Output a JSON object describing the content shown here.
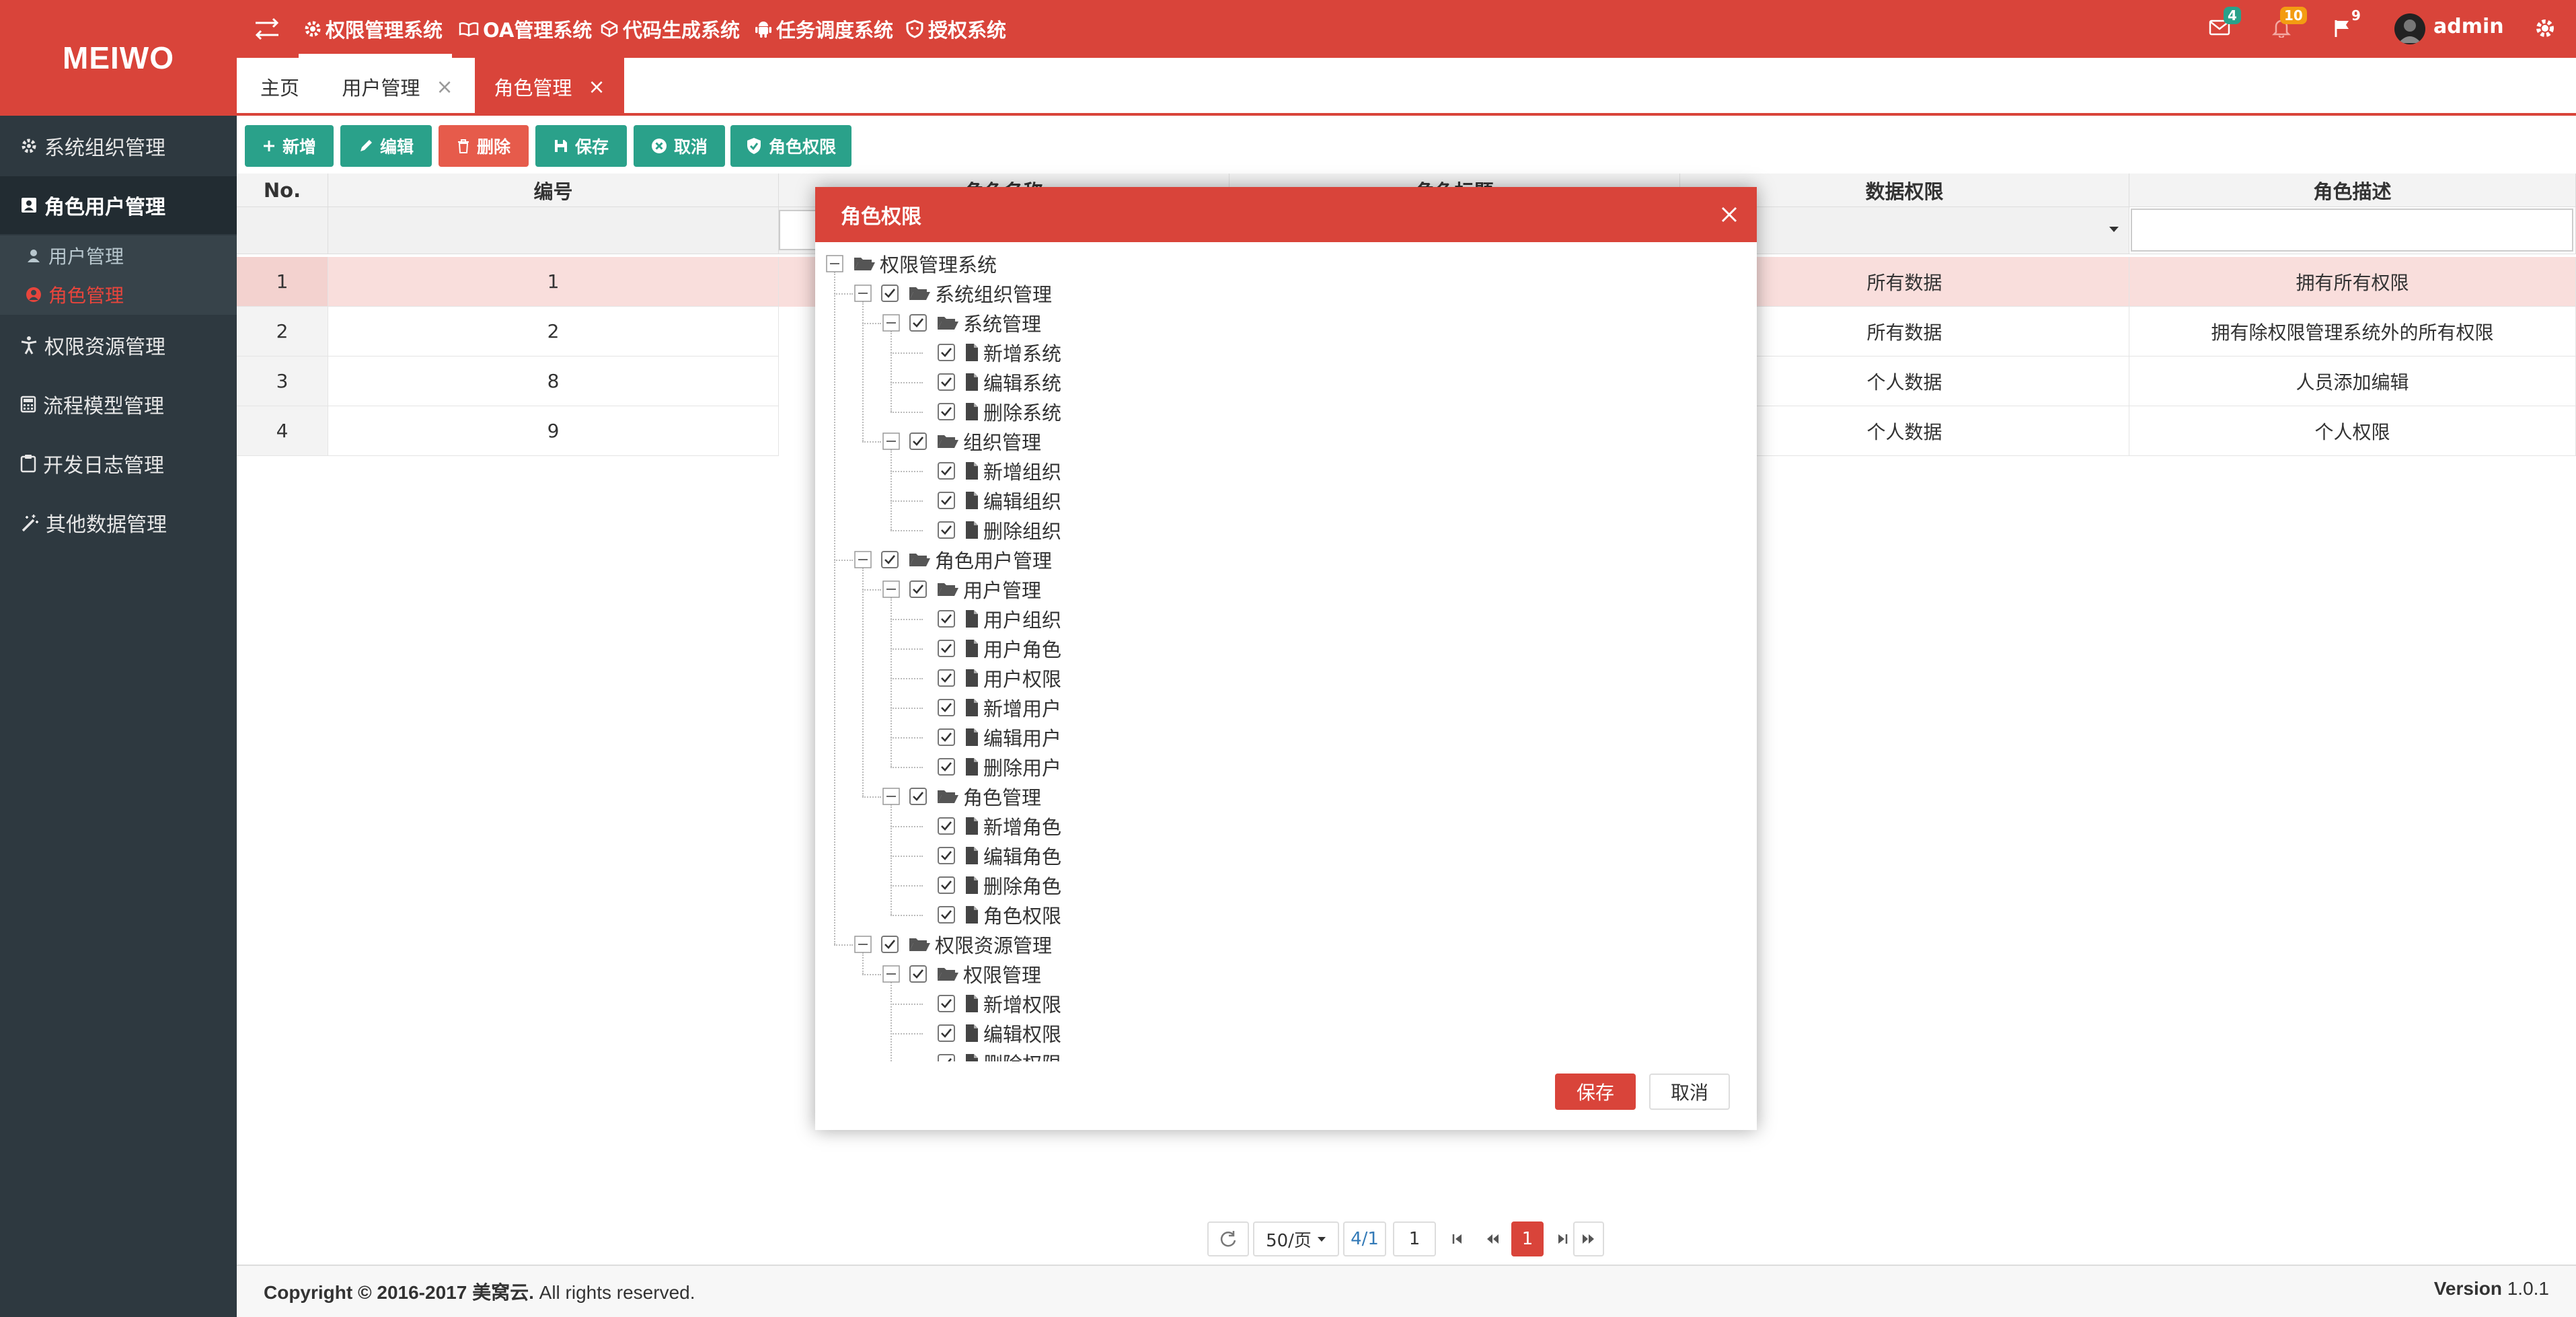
{
  "brand": {
    "logo": "MEIWO",
    "accent": "#d9443a",
    "sidebar_bg": "#2e3940",
    "teal": "#2aa18a"
  },
  "topbar": {
    "systems": [
      {
        "label": "权限管理系统",
        "icon": "gear-icon",
        "active": true
      },
      {
        "label": "OA管理系统",
        "icon": "book-icon"
      },
      {
        "label": "代码生成系统",
        "icon": "cube-icon"
      },
      {
        "label": "任务调度系统",
        "icon": "android-icon"
      },
      {
        "label": "授权系统",
        "icon": "shield-icon"
      }
    ],
    "badges": {
      "mail": "4",
      "bell": "10",
      "flag": "9"
    },
    "user": "admin"
  },
  "tabs": [
    {
      "label": "主页"
    },
    {
      "label": "用户管理",
      "closable": true
    },
    {
      "label": "角色管理",
      "closable": true,
      "active": true
    }
  ],
  "sidebar": {
    "items": [
      {
        "label": "系统组织管理",
        "icon": "gear-icon"
      },
      {
        "label": "角色用户管理",
        "icon": "id-card-icon",
        "active": true
      },
      {
        "label": "权限资源管理",
        "icon": "person-icon"
      },
      {
        "label": "流程模型管理",
        "icon": "calculator-icon"
      },
      {
        "label": "开发日志管理",
        "icon": "clipboard-icon"
      },
      {
        "label": "其他数据管理",
        "icon": "wand-icon"
      }
    ],
    "subitems": [
      {
        "label": "用户管理",
        "icon": "user-icon"
      },
      {
        "label": "角色管理",
        "icon": "user-circle-icon",
        "active": true
      }
    ]
  },
  "toolbar": {
    "add": "新增",
    "edit": "编辑",
    "delete": "删除",
    "save": "保存",
    "cancel": "取消",
    "role_perm": "角色权限"
  },
  "table": {
    "columns": [
      "No.",
      "编号",
      "角色名称",
      "角色标题",
      "数据权限",
      "角色描述"
    ],
    "rows": [
      {
        "no": "1",
        "id": "1",
        "data_perm": "所有数据",
        "desc": "拥有所有权限"
      },
      {
        "no": "2",
        "id": "2",
        "data_perm": "所有数据",
        "desc": "拥有除权限管理系统外的所有权限"
      },
      {
        "no": "3",
        "id": "8",
        "data_perm": "个人数据",
        "desc": "人员添加编辑"
      },
      {
        "no": "4",
        "id": "9",
        "data_perm": "个人数据",
        "desc": "个人权限"
      }
    ]
  },
  "dialog": {
    "title": "角色权限",
    "tree": [
      {
        "label": "权限管理系统",
        "kind": "folder",
        "depth": 0,
        "expander": true,
        "checkbox": false
      },
      {
        "label": "系统组织管理",
        "kind": "folder",
        "depth": 1,
        "expander": true,
        "checkbox": true
      },
      {
        "label": "系统管理",
        "kind": "folder",
        "depth": 2,
        "expander": true,
        "checkbox": true
      },
      {
        "label": "新增系统",
        "kind": "file",
        "depth": 3,
        "checkbox": true
      },
      {
        "label": "编辑系统",
        "kind": "file",
        "depth": 3,
        "checkbox": true
      },
      {
        "label": "删除系统",
        "kind": "file",
        "depth": 3,
        "checkbox": true
      },
      {
        "label": "组织管理",
        "kind": "folder",
        "depth": 2,
        "expander": true,
        "checkbox": true
      },
      {
        "label": "新增组织",
        "kind": "file",
        "depth": 3,
        "checkbox": true
      },
      {
        "label": "编辑组织",
        "kind": "file",
        "depth": 3,
        "checkbox": true
      },
      {
        "label": "删除组织",
        "kind": "file",
        "depth": 3,
        "checkbox": true
      },
      {
        "label": "角色用户管理",
        "kind": "folder",
        "depth": 1,
        "expander": true,
        "checkbox": true
      },
      {
        "label": "用户管理",
        "kind": "folder",
        "depth": 2,
        "expander": true,
        "checkbox": true
      },
      {
        "label": "用户组织",
        "kind": "file",
        "depth": 3,
        "checkbox": true
      },
      {
        "label": "用户角色",
        "kind": "file",
        "depth": 3,
        "checkbox": true
      },
      {
        "label": "用户权限",
        "kind": "file",
        "depth": 3,
        "checkbox": true
      },
      {
        "label": "新增用户",
        "kind": "file",
        "depth": 3,
        "checkbox": true
      },
      {
        "label": "编辑用户",
        "kind": "file",
        "depth": 3,
        "checkbox": true
      },
      {
        "label": "删除用户",
        "kind": "file",
        "depth": 3,
        "checkbox": true
      },
      {
        "label": "角色管理",
        "kind": "folder",
        "depth": 2,
        "expander": true,
        "checkbox": true
      },
      {
        "label": "新增角色",
        "kind": "file",
        "depth": 3,
        "checkbox": true
      },
      {
        "label": "编辑角色",
        "kind": "file",
        "depth": 3,
        "checkbox": true
      },
      {
        "label": "删除角色",
        "kind": "file",
        "depth": 3,
        "checkbox": true
      },
      {
        "label": "角色权限",
        "kind": "file",
        "depth": 3,
        "checkbox": true
      },
      {
        "label": "权限资源管理",
        "kind": "folder",
        "depth": 1,
        "expander": true,
        "checkbox": true
      },
      {
        "label": "权限管理",
        "kind": "folder",
        "depth": 2,
        "expander": true,
        "checkbox": true
      },
      {
        "label": "新增权限",
        "kind": "file",
        "depth": 3,
        "checkbox": true
      },
      {
        "label": "编辑权限",
        "kind": "file",
        "depth": 3,
        "checkbox": true
      },
      {
        "label": "删除权限",
        "kind": "file",
        "depth": 3,
        "checkbox": true
      }
    ],
    "save": "保存",
    "cancel": "取消"
  },
  "pager": {
    "page_size": "50/页",
    "page_info": "4/1",
    "page_input": "1",
    "current": "1"
  },
  "footer": {
    "copyright": "Copyright © 2016-2017 美窝云.",
    "rights": " All rights reserved.",
    "version_label": "Version",
    "version": " 1.0.1"
  }
}
